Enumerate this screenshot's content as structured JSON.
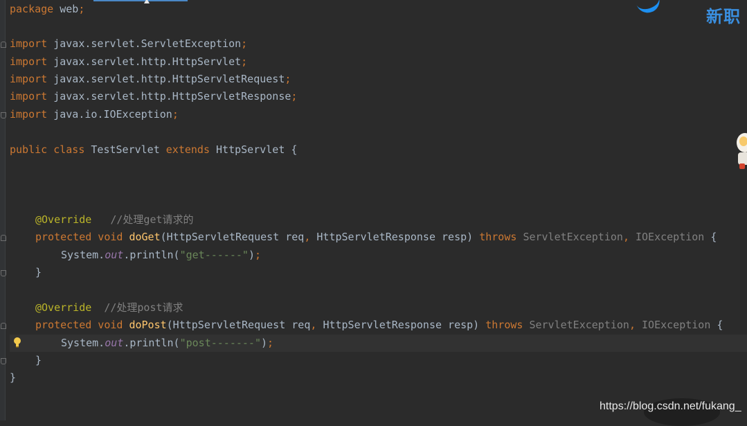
{
  "editor": {
    "lines": [
      {
        "tokens": [
          [
            "kw",
            "package"
          ],
          [
            "",
            "web"
          ],
          [
            "kw",
            ";"
          ]
        ]
      },
      {
        "tokens": []
      },
      {
        "tokens": [
          [
            "kw",
            "import"
          ],
          [
            "",
            "javax.servlet.ServletException"
          ],
          [
            "kw",
            ";"
          ]
        ]
      },
      {
        "tokens": [
          [
            "kw",
            "import"
          ],
          [
            "",
            "javax.servlet.http.HttpServlet"
          ],
          [
            "kw",
            ";"
          ]
        ]
      },
      {
        "tokens": [
          [
            "kw",
            "import"
          ],
          [
            "",
            "javax.servlet.http.HttpServletRequest"
          ],
          [
            "kw",
            ";"
          ]
        ]
      },
      {
        "tokens": [
          [
            "kw",
            "import"
          ],
          [
            "",
            "javax.servlet.http.HttpServletResponse"
          ],
          [
            "kw",
            ";"
          ]
        ]
      },
      {
        "tokens": [
          [
            "kw",
            "import"
          ],
          [
            "",
            "java.io.IOException"
          ],
          [
            "kw",
            ";"
          ]
        ]
      },
      {
        "tokens": []
      },
      {
        "tokens": [
          [
            "kw",
            "public class"
          ],
          [
            "",
            "TestServlet "
          ],
          [
            "kw",
            "extends"
          ],
          [
            "",
            "HttpServlet {"
          ]
        ]
      },
      {
        "tokens": []
      },
      {
        "tokens": []
      },
      {
        "tokens": []
      },
      {
        "tokens": [
          [
            "ann",
            "@Override"
          ],
          [
            "cm",
            "  //处理get请求的"
          ]
        ],
        "indent": 1
      },
      {
        "tokens": [
          [
            "kw",
            "protected void"
          ],
          [
            "fn",
            "doGet"
          ],
          [
            "",
            "(HttpServletRequest req"
          ],
          [
            "kw",
            ","
          ],
          [
            "",
            "HttpServletResponse resp) "
          ],
          [
            "kw",
            "throws"
          ],
          [
            "dim",
            "ServletException"
          ],
          [
            "kw",
            ","
          ],
          [
            "dim",
            "IOException"
          ],
          [
            "",
            "{"
          ]
        ],
        "indent": 1
      },
      {
        "tokens": [
          [
            "",
            "System."
          ],
          [
            "field",
            "out"
          ],
          [
            "",
            ".println("
          ],
          [
            "str",
            "\"get------\""
          ],
          [
            "",
            ")"
          ],
          [
            "kw",
            ";"
          ]
        ],
        "indent": 2
      },
      {
        "tokens": [
          [
            "",
            "}"
          ]
        ],
        "indent": 1
      },
      {
        "tokens": []
      },
      {
        "tokens": [
          [
            "ann",
            "@Override"
          ],
          [
            "cm",
            " //处理post请求"
          ]
        ],
        "indent": 1
      },
      {
        "tokens": [
          [
            "kw",
            "protected void"
          ],
          [
            "fn",
            "doPost"
          ],
          [
            "",
            "(HttpServletRequest req"
          ],
          [
            "kw",
            ","
          ],
          [
            "",
            "HttpServletResponse resp) "
          ],
          [
            "kw",
            "throws"
          ],
          [
            "dim",
            "ServletException"
          ],
          [
            "kw",
            ","
          ],
          [
            "dim",
            "IOException"
          ],
          [
            "",
            "{"
          ]
        ],
        "indent": 1
      },
      {
        "tokens": [
          [
            "",
            "System."
          ],
          [
            "field",
            "out"
          ],
          [
            "",
            ".println("
          ],
          [
            "str",
            "\"post-------\""
          ],
          [
            "",
            ")"
          ],
          [
            "kw",
            ";"
          ]
        ],
        "indent": 2,
        "current": true
      },
      {
        "tokens": [
          [
            "",
            "}"
          ]
        ],
        "indent": 1
      },
      {
        "tokens": [
          [
            "",
            "}"
          ]
        ]
      }
    ]
  },
  "overlay": {
    "brand_text": "新职",
    "watermark": "https://blog.csdn.net/fukang_"
  },
  "icons": {
    "bulb": "lightbulb-icon",
    "mascot": "mascot-icon"
  },
  "colors": {
    "background": "#2b2b2b",
    "keyword": "#cc7832",
    "annotation": "#bbb529",
    "method": "#ffc66d",
    "string": "#6a8759",
    "comment": "#808080",
    "field": "#9876aa",
    "text": "#a9b7c6"
  }
}
